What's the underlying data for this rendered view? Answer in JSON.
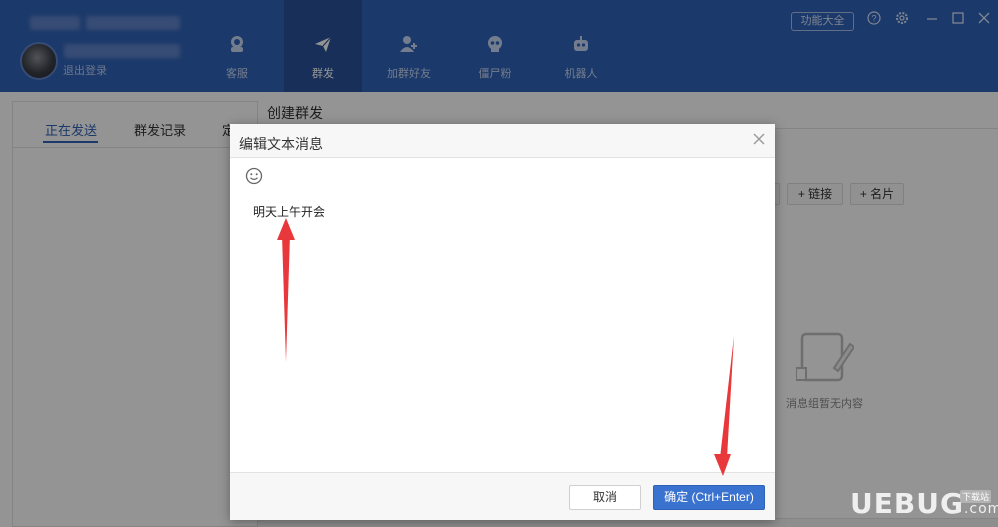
{
  "header": {
    "logout_label": "退出登录",
    "nav": [
      {
        "label": "客服",
        "icon": "headset-icon"
      },
      {
        "label": "群发",
        "icon": "paper-plane-icon"
      },
      {
        "label": "加群好友",
        "icon": "add-friend-icon"
      },
      {
        "label": "僵尸粉",
        "icon": "skull-icon"
      },
      {
        "label": "机器人",
        "icon": "robot-icon"
      }
    ],
    "function_button": "功能大全",
    "window_icons": [
      "help-icon",
      "settings-icon",
      "minimize-icon",
      "maximize-icon",
      "close-icon"
    ]
  },
  "left_tabs": [
    "正在发送",
    "群发记录",
    "定"
  ],
  "right_panel": {
    "title": "创建群发",
    "chips": [
      "+ 链接",
      "+ 名片"
    ],
    "empty_text": "消息组暂无内容"
  },
  "dialog": {
    "title": "编辑文本消息",
    "message_text": "明天上午开会",
    "cancel_label": "取消",
    "confirm_label": "确定 (Ctrl+Enter)"
  },
  "watermark": {
    "brand": "UEBUG",
    "suffix": ".com",
    "tag": "下载站"
  },
  "colors": {
    "brand_blue": "#2f62b7",
    "accent_button": "#3a72d0",
    "arrow_red": "#e8383b"
  }
}
